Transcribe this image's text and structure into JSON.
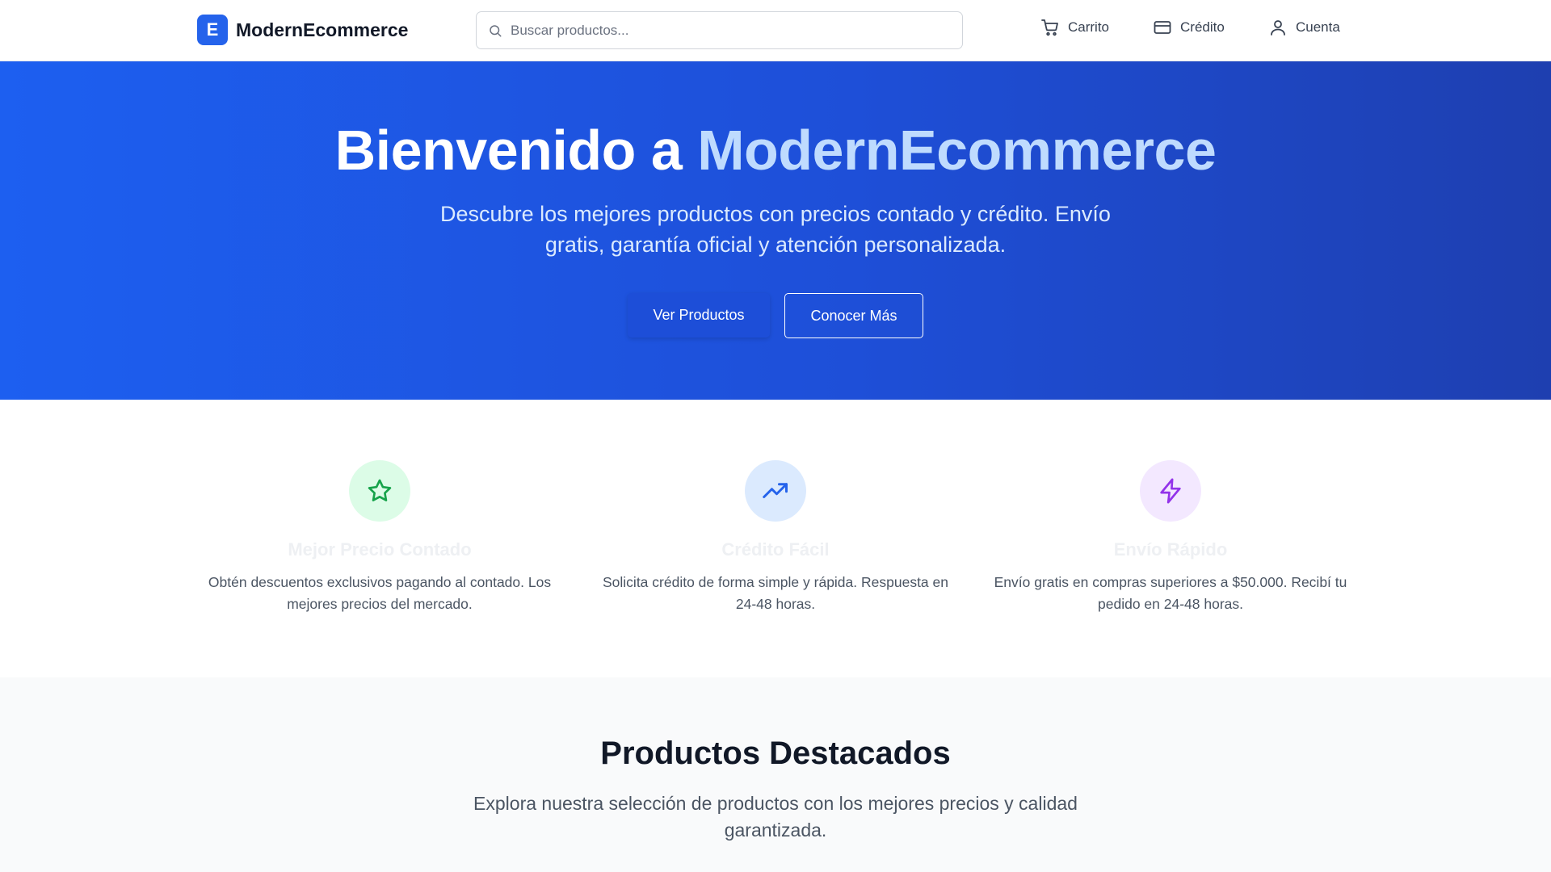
{
  "header": {
    "logo_letter": "E",
    "logo_text": "ModernEcommerce",
    "search_placeholder": "Buscar productos...",
    "nav": {
      "cart": "Carrito",
      "credit": "Crédito",
      "account": "Cuenta"
    }
  },
  "hero": {
    "title_prefix": "Bienvenido a ",
    "title_accent": "ModernEcommerce",
    "subtitle": "Descubre los mejores productos con precios contado y crédito. Envío gratis, garantía oficial y atención personalizada.",
    "primary_button": "Ver Productos",
    "secondary_button": "Conocer Más"
  },
  "features": [
    {
      "icon": "star-icon",
      "title": "Mejor Precio Contado",
      "description": "Obtén descuentos exclusivos pagando al contado. Los mejores precios del mercado."
    },
    {
      "icon": "trending-up-icon",
      "title": "Crédito Fácil",
      "description": "Solicita crédito de forma simple y rápida. Respuesta en 24-48 horas."
    },
    {
      "icon": "lightning-icon",
      "title": "Envío Rápido",
      "description": "Envío gratis en compras superiores a $50.000. Recibí tu pedido en 24-48 horas."
    }
  ],
  "featured": {
    "title": "Productos Destacados",
    "subtitle": "Explora nuestra selección de productos con los mejores precios y calidad garantizada."
  },
  "colors": {
    "brand": "#2563eb",
    "hero_start": "#1d5ff0",
    "hero_end": "#1e3fb0",
    "accent_text": "#bfdbfe",
    "feature_green": "#16a34a",
    "feature_blue": "#2563eb",
    "feature_purple": "#9333ea"
  }
}
